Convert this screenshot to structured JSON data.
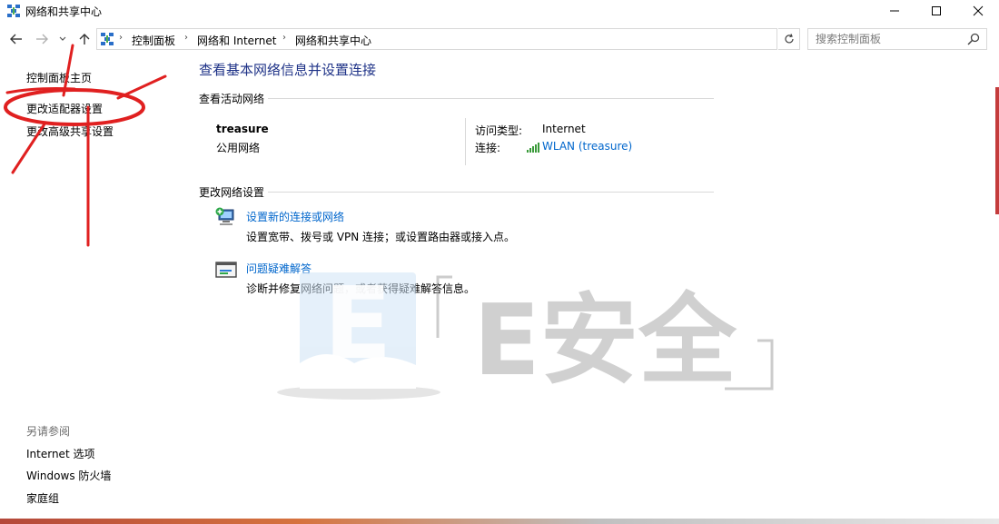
{
  "window": {
    "title": "网络和共享中心"
  },
  "navigation": {
    "back_icon": "back-arrow-icon",
    "forward_icon": "forward-arrow-icon",
    "recent_icon": "chevron-down-icon",
    "up_icon": "up-arrow-icon"
  },
  "address": {
    "crumbs": [
      "控制面板",
      "网络和 Internet",
      "网络和共享中心"
    ]
  },
  "search": {
    "placeholder": "搜索控制面板"
  },
  "left_pane": {
    "home": "控制面板主页",
    "adapter_settings": "更改适配器设置",
    "advanced_sharing": "更改高级共享设置",
    "see_also_label": "另请参阅",
    "see_also": [
      "Internet 选项",
      "Windows 防火墙",
      "家庭组"
    ]
  },
  "main": {
    "title": "查看基本网络信息并设置连接",
    "active_header": "查看活动网络",
    "network": {
      "name": "treasure",
      "category": "公用网络",
      "access_label": "访问类型:",
      "access_value": "Internet",
      "connection_label": "连接:",
      "connection_value": "WLAN (treasure)"
    },
    "change_header": "更改网络设置",
    "tasks": [
      {
        "link": "设置新的连接或网络",
        "desc": "设置宽带、拨号或 VPN 连接；或设置路由器或接入点。"
      },
      {
        "link": "问题疑难解答",
        "desc": "诊断并修复网络问题，或者获得疑难解答信息。"
      }
    ]
  },
  "watermark": {
    "logo_letter": "E",
    "text": "E安全"
  },
  "colors": {
    "title_blue": "#1e3287",
    "link_blue": "#0066cc",
    "annotation_red": "#e02020"
  }
}
